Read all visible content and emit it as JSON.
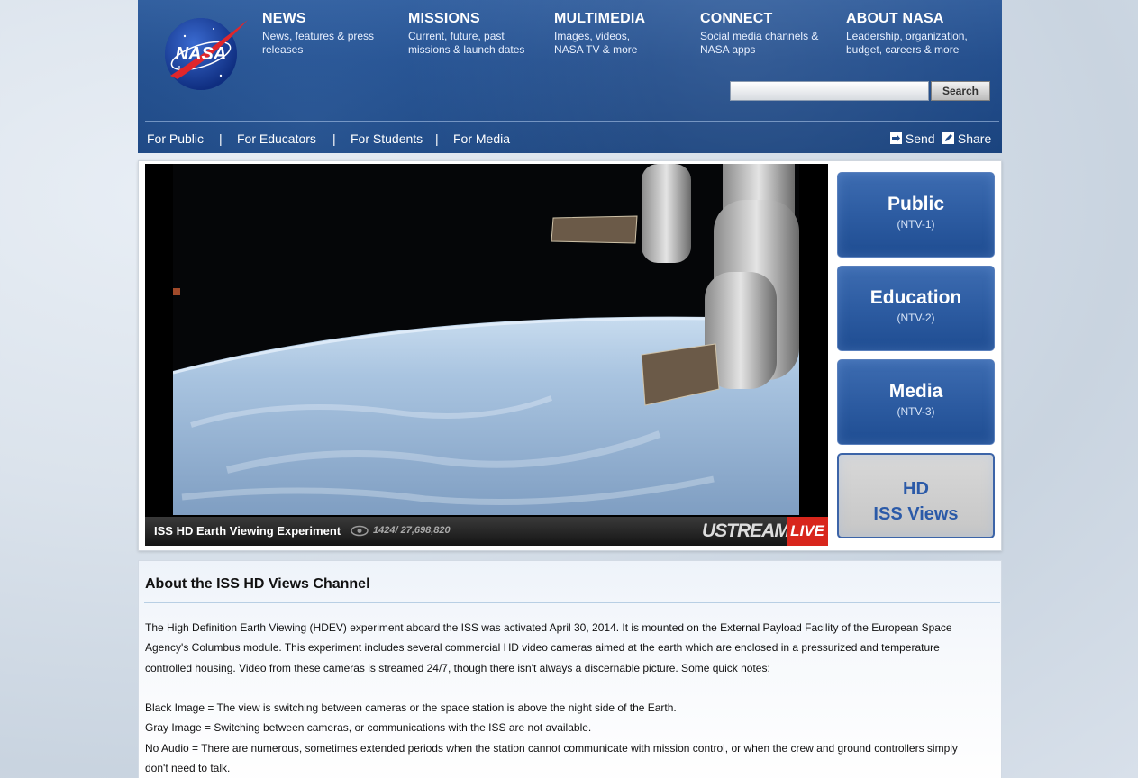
{
  "header": {
    "logo_text": "NASA",
    "nav": [
      {
        "title": "NEWS",
        "desc": "News, features & press releases"
      },
      {
        "title": "MISSIONS",
        "desc": "Current, future, past missions & launch dates"
      },
      {
        "title": "MULTIMEDIA",
        "desc": "Images, videos, NASA TV & more"
      },
      {
        "title": "CONNECT",
        "desc": "Social media channels & NASA apps"
      },
      {
        "title": "ABOUT NASA",
        "desc": "Leadership, organization, budget, careers & more"
      }
    ],
    "search": {
      "placeholder": "",
      "button": "Search"
    },
    "subnav": [
      "For Public",
      "For Educators",
      "For Students",
      "For Media"
    ],
    "separator": "|",
    "send": "Send",
    "share": "Share"
  },
  "video": {
    "title": "ISS HD Earth Viewing Experiment",
    "views": "1424/ 27,698,820",
    "brand": "USTREAM",
    "live": "LIVE"
  },
  "channels": [
    {
      "name": "Public",
      "code": "(NTV-1)"
    },
    {
      "name": "Education",
      "code": "(NTV-2)"
    },
    {
      "name": "Media",
      "code": "(NTV-3)"
    },
    {
      "name_line1": "HD",
      "name_line2": "ISS Views"
    }
  ],
  "about": {
    "heading": "About the ISS HD Views Channel",
    "intro_1": "The High Definition Earth Viewing (HDEV) experiment aboard the ISS was activated April 30, 2014. It is mounted on the External Payload Facility of the European Space",
    "intro_2": "Agency's Columbus module. This experiment includes several commercial HD video cameras aimed at the earth which are enclosed in a pressurized and temperature",
    "intro_3": "controlled housing. Video from these cameras is streamed 24/7, though there isn't always a discernable picture. Some quick notes:",
    "note_black": "Black Image = The view is switching between cameras or the space station is above the night side of the Earth.",
    "note_gray": "Gray Image = Switching between cameras, or communications with the ISS are not available.",
    "note_audio_1": "No Audio = There are numerous, sometimes extended periods when the station cannot communicate with mission control, or when the crew and ground controllers simply",
    "note_audio_2": "don't need to talk."
  },
  "colors": {
    "header_blue": "#1f4a88",
    "channel_blue": "#2d5ca2",
    "live_red": "#d8261c",
    "hd_text": "#2b5aa8"
  }
}
